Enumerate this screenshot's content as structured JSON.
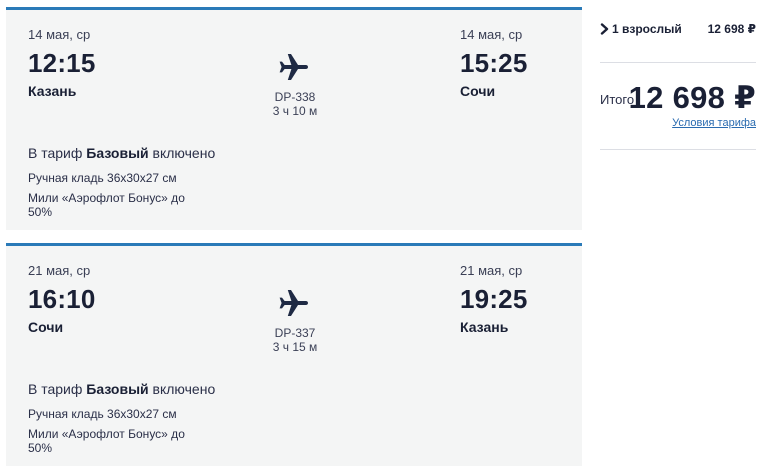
{
  "flights": [
    {
      "dep_date": "14 мая, ср",
      "dep_time": "12:15",
      "dep_city": "Казань",
      "flight_no": "DP-338",
      "duration": "3 ч 10 м",
      "arr_date": "14 мая, ср",
      "arr_time": "15:25",
      "arr_city": "Сочи",
      "tariff_prefix": "В тариф",
      "tariff_name": "Базовый",
      "tariff_suffix": "включено",
      "baggage": "Ручная кладь 36х30х27 см",
      "miles": "Мили «Аэрофлот Бонус» до 50%"
    },
    {
      "dep_date": "21 мая, ср",
      "dep_time": "16:10",
      "dep_city": "Сочи",
      "flight_no": "DP-337",
      "duration": "3 ч 15 м",
      "arr_date": "21 мая, ср",
      "arr_time": "19:25",
      "arr_city": "Казань",
      "tariff_prefix": "В тариф",
      "tariff_name": "Базовый",
      "tariff_suffix": "включено",
      "baggage": "Ручная кладь 36х30х27 см",
      "miles": "Мили «Аэрофлот Бонус» до 50%"
    }
  ],
  "summary": {
    "passengers_label": "1 взрослый",
    "passengers_price": "12 698 ₽",
    "total_label": "Итого",
    "total_value": "12 698 ₽",
    "tariff_conditions_link": "Условия тарифа",
    "icons": {
      "expand": "chevron-right-icon",
      "flight": "airplane-icon"
    },
    "colors": {
      "accent": "#2a7ab8",
      "link": "#2a6bb0",
      "text": "#1a2035",
      "card_bg": "#f4f5f5"
    }
  }
}
